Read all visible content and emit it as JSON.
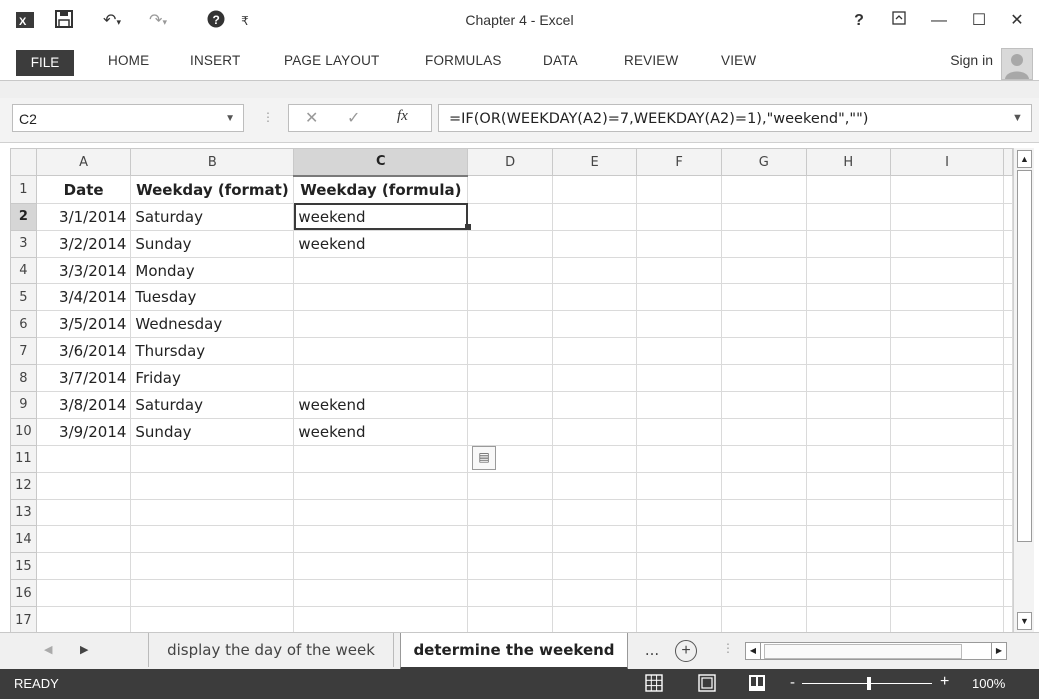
{
  "window": {
    "title": "Chapter 4 - Excel",
    "help": "?",
    "minimize": "—",
    "maximize": "☐",
    "close": "✕"
  },
  "quick_access": {
    "excel_icon": "excel-icon",
    "save_icon": "save-icon",
    "undo_icon": "undo-icon",
    "redo_icon": "redo-icon",
    "help_icon": "help-icon"
  },
  "ribbon": {
    "tabs": [
      "FILE",
      "HOME",
      "INSERT",
      "PAGE LAYOUT",
      "FORMULAS",
      "DATA",
      "REVIEW",
      "VIEW"
    ],
    "sign_in": "Sign in"
  },
  "formula_bar": {
    "name_box": "C2",
    "cancel": "✕",
    "enter": "✓",
    "fx": "fx",
    "formula": "=IF(OR(WEEKDAY(A2)=7,WEEKDAY(A2)=1),\"weekend\",\"\")"
  },
  "sheet": {
    "columns": [
      "A",
      "B",
      "C",
      "D",
      "E",
      "F",
      "G",
      "H",
      "I"
    ],
    "rows": [
      [
        "Date",
        "Weekday (format)",
        "Weekday (formula)"
      ],
      [
        "3/1/2014",
        "Saturday",
        "weekend"
      ],
      [
        "3/2/2014",
        "Sunday",
        "weekend"
      ],
      [
        "3/3/2014",
        "Monday",
        ""
      ],
      [
        "3/4/2014",
        "Tuesday",
        ""
      ],
      [
        "3/5/2014",
        "Wednesday",
        ""
      ],
      [
        "3/6/2014",
        "Thursday",
        ""
      ],
      [
        "3/7/2014",
        "Friday",
        ""
      ],
      [
        "3/8/2014",
        "Saturday",
        "weekend"
      ],
      [
        "3/9/2014",
        "Sunday",
        "weekend"
      ],
      [
        "",
        "",
        ""
      ],
      [
        "",
        "",
        ""
      ],
      [
        "",
        "",
        ""
      ],
      [
        "",
        "",
        ""
      ],
      [
        "",
        "",
        ""
      ],
      [
        "",
        "",
        ""
      ],
      [
        "",
        "",
        ""
      ]
    ],
    "active_cell": "C2"
  },
  "sheet_tabs": {
    "tab1": "display the day of the week",
    "tab2": "determine the weekend",
    "more": "...",
    "add": "+"
  },
  "status": {
    "ready": "READY",
    "zoom": "100%",
    "zoom_minus": "-",
    "zoom_plus": "+"
  }
}
